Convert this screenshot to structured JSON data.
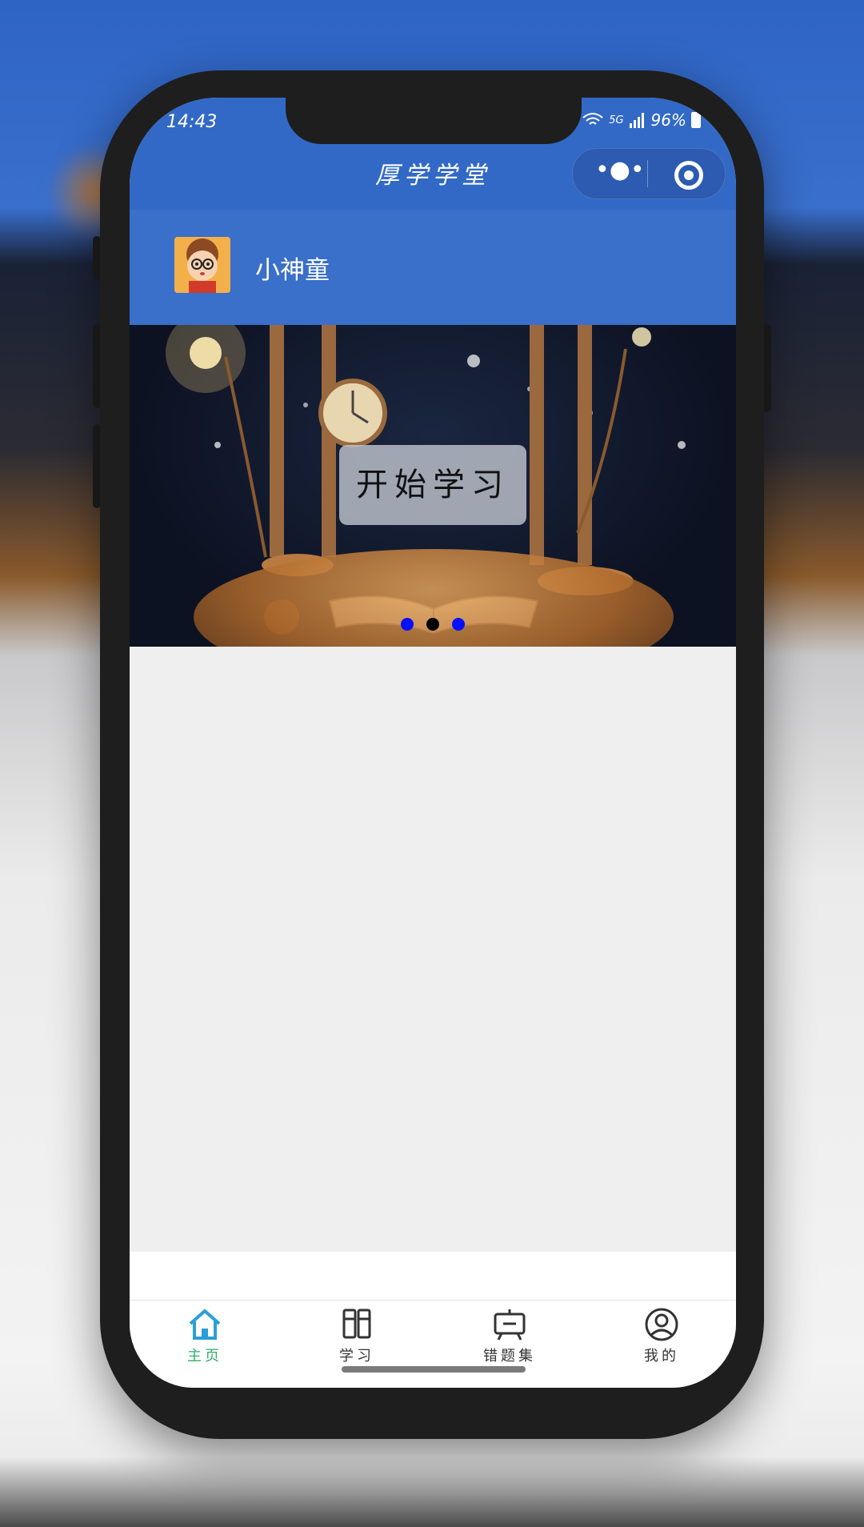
{
  "status_bar": {
    "time": "14:43",
    "network": "5G",
    "battery": "96%"
  },
  "header": {
    "title": "厚学学堂",
    "menu_icon": "more-dots-icon",
    "close_icon": "target-icon"
  },
  "profile": {
    "username": "小神童"
  },
  "banner": {
    "button_label": "开始学习",
    "pages": 3,
    "active_page": 2
  },
  "tabbar": {
    "items": [
      {
        "label": "主页",
        "icon": "home-icon",
        "active": true
      },
      {
        "label": "学习",
        "icon": "book-icon",
        "active": false
      },
      {
        "label": "错题集",
        "icon": "board-icon",
        "active": false
      },
      {
        "label": "我的",
        "icon": "user-icon",
        "active": false
      }
    ]
  },
  "colors": {
    "primary": "#3269c6",
    "active_tab": "#2fae6b",
    "dot_inactive": "#0010ff"
  }
}
